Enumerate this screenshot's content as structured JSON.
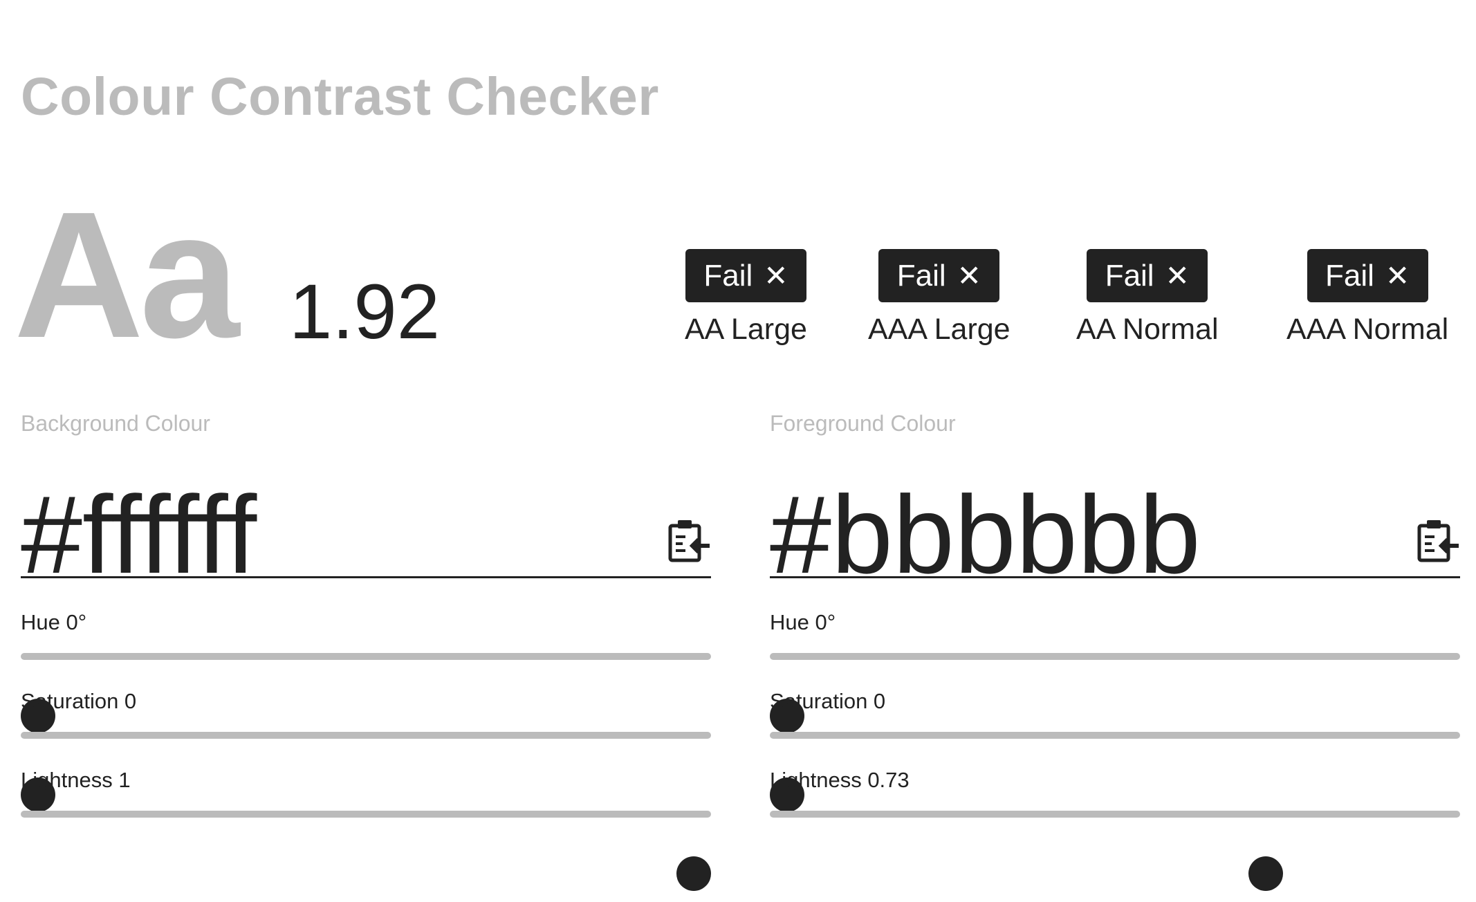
{
  "title": "Colour Contrast Checker",
  "sample_text": "Aa",
  "ratio": "1.92",
  "results": [
    {
      "badge": "Fail",
      "icon": "close-icon",
      "label": "AA Large"
    },
    {
      "badge": "Fail",
      "icon": "close-icon",
      "label": "AAA Large"
    },
    {
      "badge": "Fail",
      "icon": "close-icon",
      "label": "AA Normal"
    },
    {
      "badge": "Fail",
      "icon": "close-icon",
      "label": "AAA Normal"
    }
  ],
  "background": {
    "label": "Background Colour",
    "hex": "#ffffff",
    "paste_icon": "clipboard-paste-icon",
    "hue": {
      "label": "Hue 0°",
      "value": 0,
      "max": 360
    },
    "saturation": {
      "label": "Saturation 0",
      "value": 0,
      "max": 1
    },
    "lightness": {
      "label": "Lightness 1",
      "value": 1,
      "max": 1
    }
  },
  "foreground": {
    "label": "Foreground Colour",
    "hex": "#bbbbbb",
    "paste_icon": "clipboard-paste-icon",
    "hue": {
      "label": "Hue 0°",
      "value": 0,
      "max": 360
    },
    "saturation": {
      "label": "Saturation 0",
      "value": 0,
      "max": 1
    },
    "lightness": {
      "label": "Lightness 0.73",
      "value": 0.73,
      "max": 1
    }
  },
  "colors": {
    "text": "#222222",
    "muted": "#bbbbbb",
    "track": "#bbbbbb",
    "badge_bg": "#222222",
    "badge_text": "#ffffff"
  }
}
